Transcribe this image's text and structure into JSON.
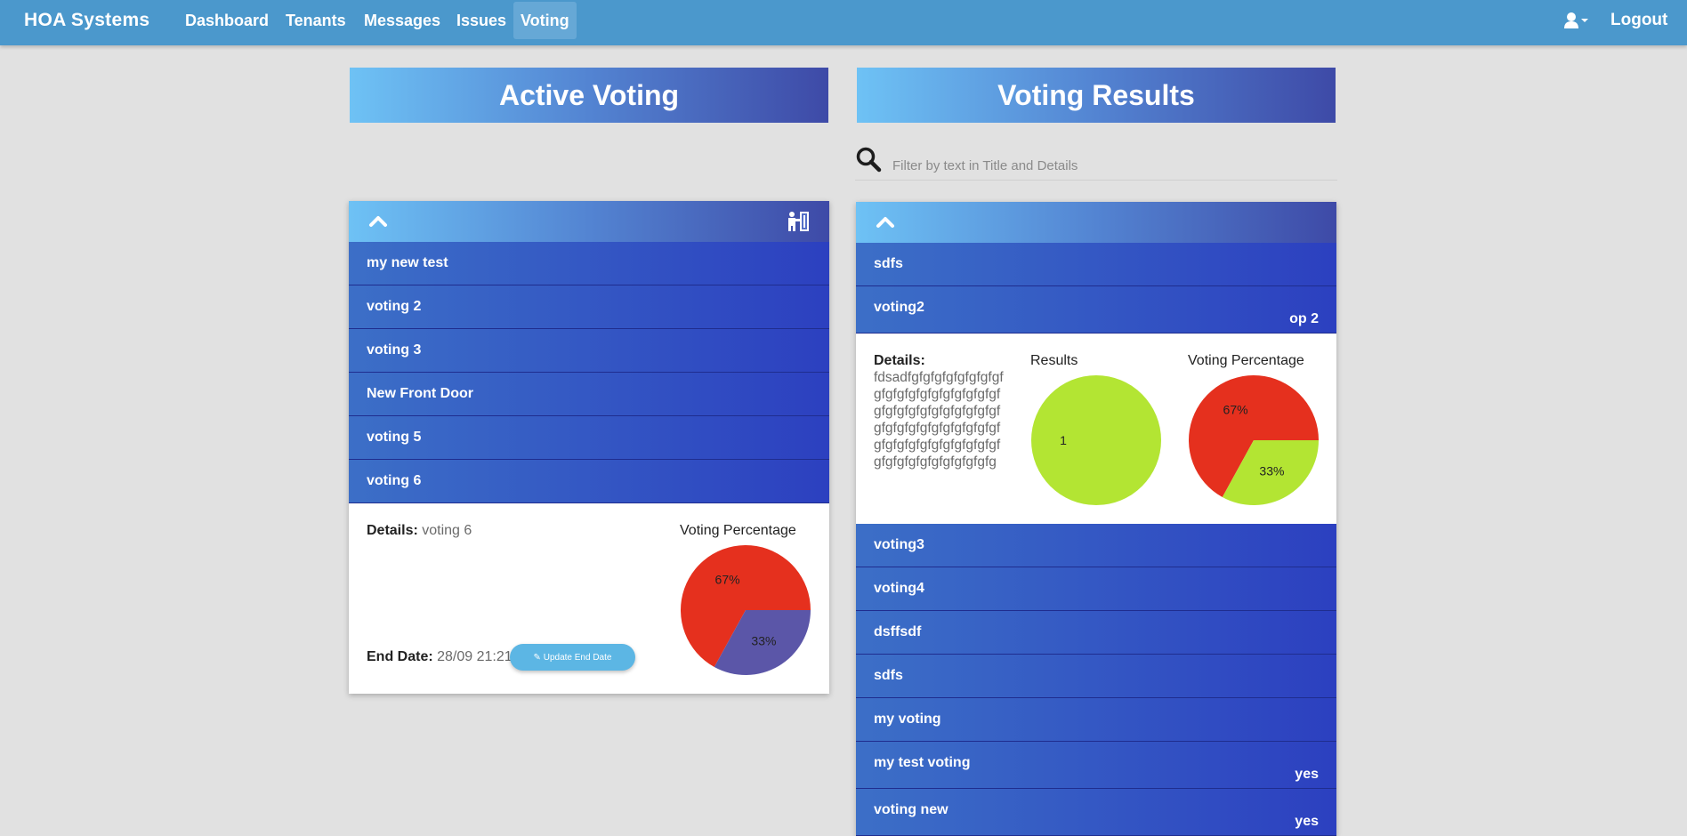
{
  "app": {
    "brand": "HOA Systems"
  },
  "nav": {
    "items": [
      "Dashboard",
      "Tenants",
      "Messages",
      "Issues",
      "Voting"
    ],
    "active": "Voting",
    "logout": "Logout",
    "user_icon": "user-icon"
  },
  "active_voting": {
    "title": "Active Voting",
    "items": [
      "my new test",
      "voting 2",
      "voting 3",
      "New Front Door",
      "voting 5",
      "voting 6"
    ],
    "expanded": {
      "details_label": "Details:",
      "details_value": "voting 6",
      "end_label": "End Date:",
      "end_value": "28/09 21:21",
      "update_button": "Update End Date",
      "chart_title": "Voting Percentage",
      "chart_data": {
        "type": "pie",
        "title": "Voting Percentage",
        "slices": [
          {
            "value": 67,
            "label": "67%",
            "color": "#e5301e"
          },
          {
            "value": 33,
            "label": "33%",
            "color": "#5b56a8"
          }
        ]
      }
    }
  },
  "voting_results": {
    "title": "Voting Results",
    "search_placeholder": "Filter by text in Title and Details",
    "items": [
      {
        "label": "sdfs",
        "right": ""
      },
      {
        "label": "voting2",
        "right": "op 2",
        "expanded": true
      },
      {
        "label": "voting3",
        "right": ""
      },
      {
        "label": "voting4",
        "right": ""
      },
      {
        "label": "dsffsdf",
        "right": ""
      },
      {
        "label": "sdfs",
        "right": ""
      },
      {
        "label": "my voting",
        "right": ""
      },
      {
        "label": "my test voting",
        "right": "yes"
      },
      {
        "label": "voting new",
        "right": "yes"
      }
    ],
    "expanded": {
      "details_label": "Details:",
      "details_value": "fdsadfgfgfgfgfgfgfgfgfgfgfgfgfgfgfgfgfgfgfgfgfgfgfgfgfgfgfgfgfgfgfgfgfgfgfgfgfgfgfgfgfgfgfgfgfgfgfgfgfgfgfgfgfgfgfgfgfgfgfgfgfgfgfg",
      "results_title": "Results",
      "percentage_title": "Voting Percentage",
      "chart_data": [
        {
          "type": "pie",
          "title": "Results",
          "slices": [
            {
              "value": 1,
              "label": "1",
              "color": "#b3e533"
            }
          ]
        },
        {
          "type": "pie",
          "title": "Voting Percentage",
          "slices": [
            {
              "value": 67,
              "label": "67%",
              "color": "#e5301e"
            },
            {
              "value": 33,
              "label": "33%",
              "color": "#b3e533"
            }
          ]
        }
      ]
    }
  }
}
